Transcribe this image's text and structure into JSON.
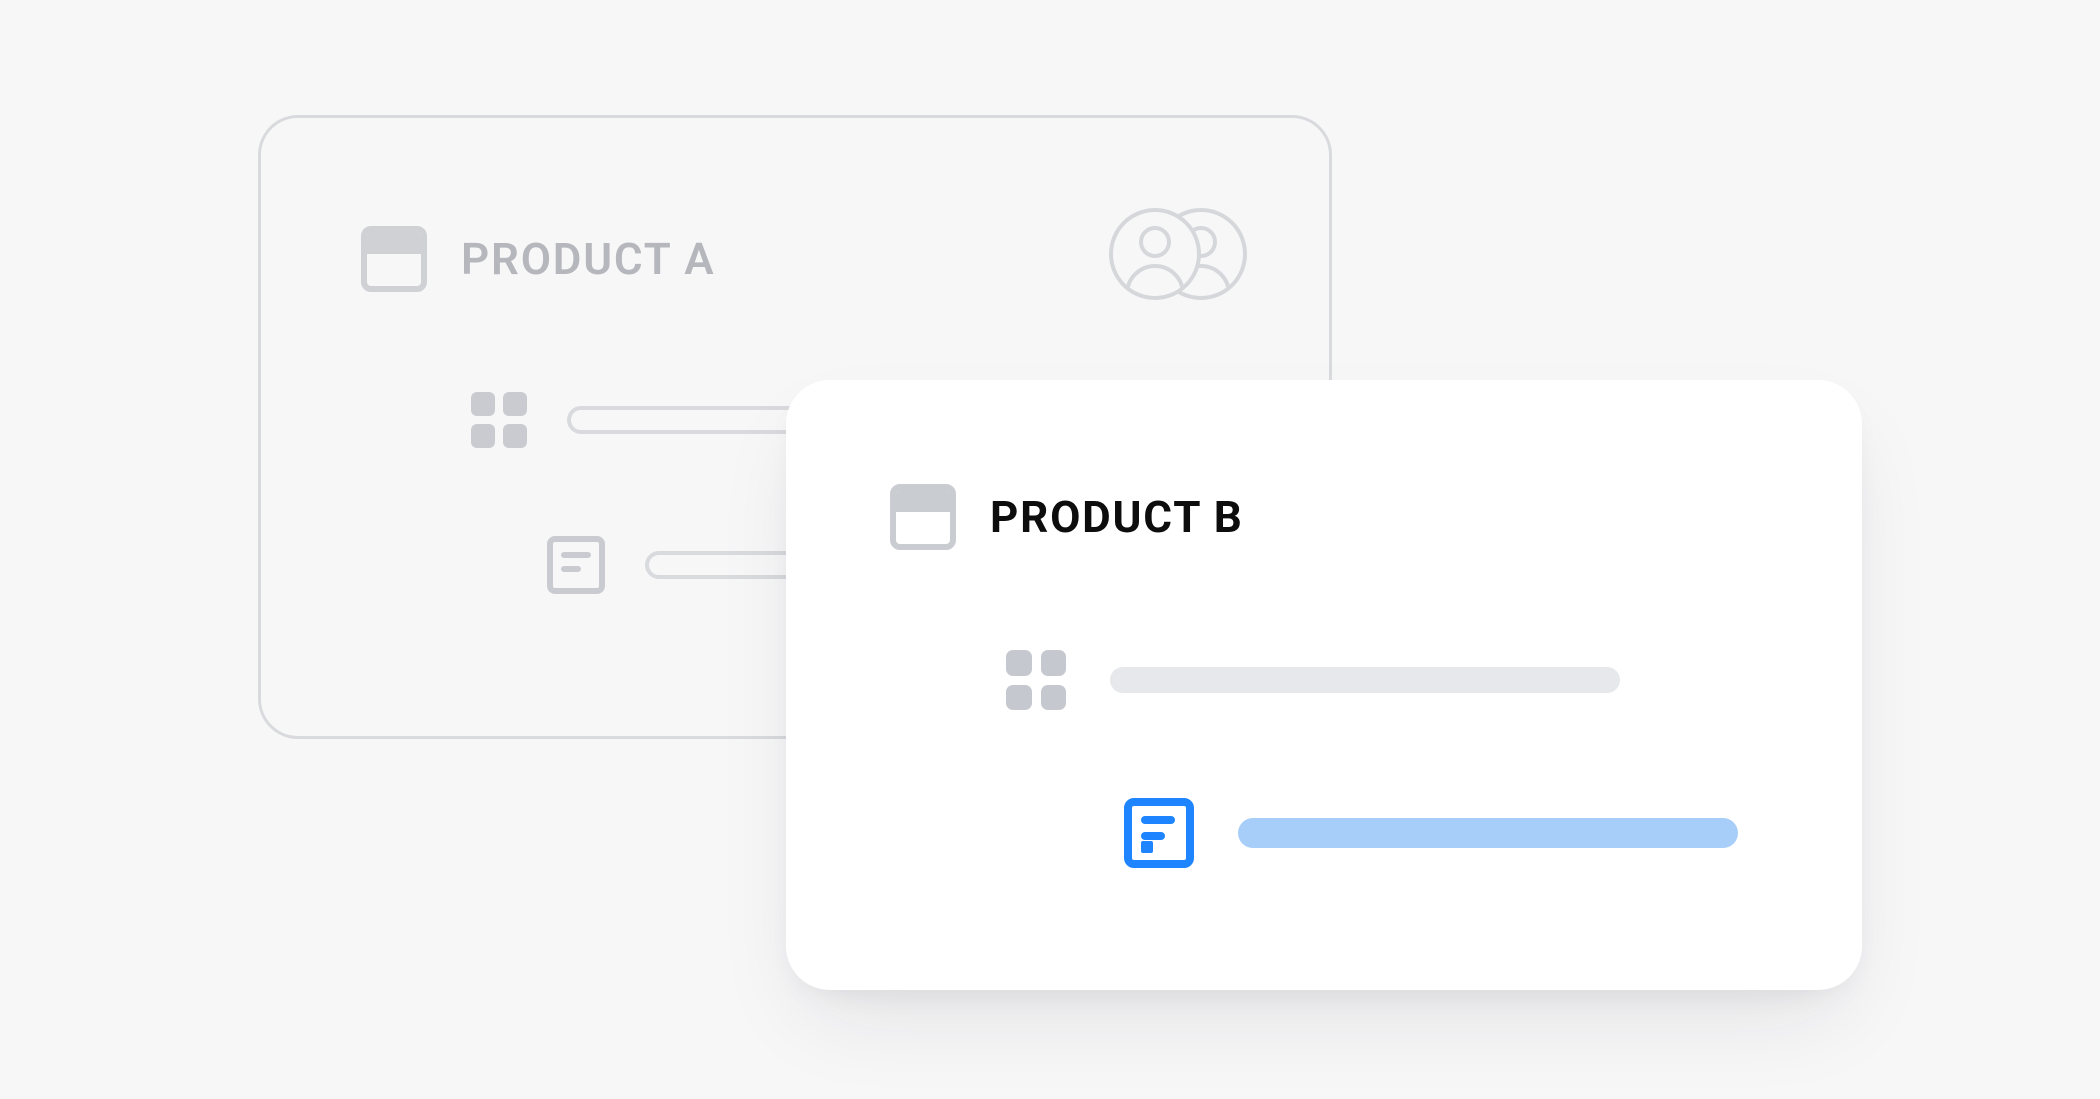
{
  "cardA": {
    "title": "PRODUCT A"
  },
  "cardB": {
    "title": "PRODUCT B"
  },
  "colors": {
    "background": "#f7f7f8",
    "mutedBorder": "#d9dadd",
    "mutedIcon": "#c9cbd0",
    "mutedText": "#b5b7bd",
    "cardWhite": "#ffffff",
    "greyPill": "#e7e8eb",
    "accentBlue": "#1f84ff",
    "accentBlueLight": "#a7cdf9",
    "titleDark": "#0d0d0d"
  }
}
